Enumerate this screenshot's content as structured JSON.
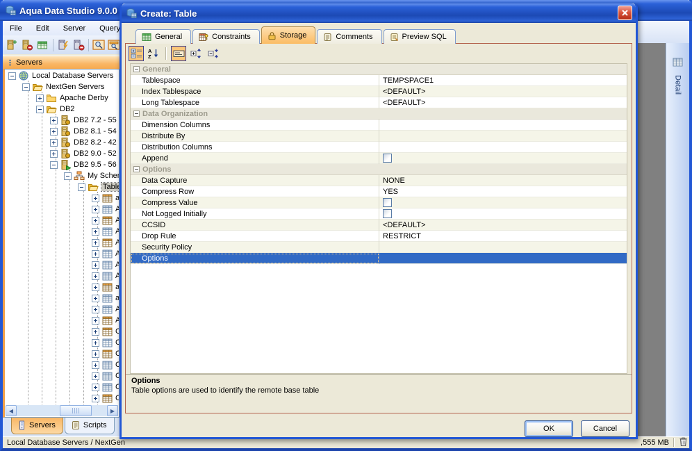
{
  "window": {
    "title": "Aqua Data Studio 9.0.0",
    "controls": [
      "minimize",
      "maximize",
      "close"
    ]
  },
  "menubar": {
    "items": [
      "File",
      "Edit",
      "Server",
      "Query"
    ]
  },
  "main_toolbar": {
    "buttons": [
      "register-server",
      "remove-server",
      "new-table",
      "connect-server",
      "disconnect-server",
      "query-analyzer",
      "query-window"
    ]
  },
  "sidebar": {
    "header": "Servers",
    "tree": [
      {
        "label": "Local Database Servers",
        "depth": 0,
        "icon": "globe",
        "toggle": "minus"
      },
      {
        "label": "NextGen Servers",
        "depth": 1,
        "icon": "folder-open",
        "toggle": "minus"
      },
      {
        "label": "Apache Derby",
        "depth": 2,
        "icon": "folder",
        "toggle": "plus"
      },
      {
        "label": "DB2",
        "depth": 2,
        "icon": "folder-open",
        "toggle": "minus"
      },
      {
        "label": "DB2 7.2 - 55",
        "depth": 3,
        "icon": "server",
        "toggle": "plus"
      },
      {
        "label": "DB2 8.1 - 54",
        "depth": 3,
        "icon": "server",
        "toggle": "plus"
      },
      {
        "label": "DB2 8.2 - 42",
        "depth": 3,
        "icon": "server",
        "toggle": "plus"
      },
      {
        "label": "DB2 9.0 - 52",
        "depth": 3,
        "icon": "server",
        "toggle": "plus"
      },
      {
        "label": "DB2 9.5 - 56",
        "depth": 3,
        "icon": "server-connected",
        "toggle": "minus"
      },
      {
        "label": "My Schem",
        "depth": 4,
        "icon": "schema",
        "toggle": "minus"
      },
      {
        "label": "Table",
        "depth": 5,
        "icon": "folder-open",
        "toggle": "minus",
        "selected": true
      },
      {
        "label": "a",
        "depth": 6,
        "icon": "table-orange",
        "toggle": "plus"
      },
      {
        "label": "A",
        "depth": 6,
        "icon": "table",
        "toggle": "plus"
      },
      {
        "label": "A",
        "depth": 6,
        "icon": "table-orange",
        "toggle": "plus"
      },
      {
        "label": "A",
        "depth": 6,
        "icon": "table",
        "toggle": "plus"
      },
      {
        "label": "A",
        "depth": 6,
        "icon": "table-orange",
        "toggle": "plus"
      },
      {
        "label": "A",
        "depth": 6,
        "icon": "table",
        "toggle": "plus"
      },
      {
        "label": "A",
        "depth": 6,
        "icon": "table",
        "toggle": "plus"
      },
      {
        "label": "A",
        "depth": 6,
        "icon": "table",
        "toggle": "plus"
      },
      {
        "label": "a",
        "depth": 6,
        "icon": "table-orange",
        "toggle": "plus"
      },
      {
        "label": "a",
        "depth": 6,
        "icon": "table",
        "toggle": "plus"
      },
      {
        "label": "A",
        "depth": 6,
        "icon": "table",
        "toggle": "plus"
      },
      {
        "label": "A",
        "depth": 6,
        "icon": "table-orange",
        "toggle": "plus"
      },
      {
        "label": "C",
        "depth": 6,
        "icon": "table-orange",
        "toggle": "plus"
      },
      {
        "label": "C",
        "depth": 6,
        "icon": "table",
        "toggle": "plus"
      },
      {
        "label": "C",
        "depth": 6,
        "icon": "table-orange",
        "toggle": "plus"
      },
      {
        "label": "C",
        "depth": 6,
        "icon": "table",
        "toggle": "plus"
      },
      {
        "label": "C",
        "depth": 6,
        "icon": "table",
        "toggle": "plus"
      },
      {
        "label": "C",
        "depth": 6,
        "icon": "table",
        "toggle": "plus"
      },
      {
        "label": "C",
        "depth": 6,
        "icon": "table-orange",
        "toggle": "plus"
      }
    ],
    "tabs": [
      {
        "label": "Servers",
        "icon": "computer",
        "active": true
      },
      {
        "label": "Scripts",
        "icon": "script",
        "active": false
      }
    ]
  },
  "statusbar": {
    "left": "Local Database Servers / NextGen",
    "memory": ",555 MB"
  },
  "detail_panel": {
    "label": "Detail"
  },
  "dialog": {
    "title": "Create: Table",
    "tabs": [
      {
        "label": "General",
        "icon": "general",
        "active": false
      },
      {
        "label": "Constraints",
        "icon": "constraints",
        "active": false
      },
      {
        "label": "Storage",
        "icon": "storage",
        "active": true
      },
      {
        "label": "Comments",
        "icon": "comments",
        "active": false
      },
      {
        "label": "Preview SQL",
        "icon": "preview-sql",
        "active": false
      }
    ],
    "toolbar": [
      {
        "icon": "categorized",
        "pressed": true
      },
      {
        "icon": "sort-az",
        "pressed": false
      },
      {
        "icon": "separator"
      },
      {
        "icon": "description",
        "pressed": true
      },
      {
        "icon": "expand-all",
        "pressed": false
      },
      {
        "icon": "collapse-all",
        "pressed": false
      }
    ],
    "grid": {
      "rows": [
        {
          "type": "category",
          "label": "General"
        },
        {
          "type": "property",
          "name": "Tablespace",
          "kind": "text",
          "value": "TEMPSPACE1"
        },
        {
          "type": "property",
          "name": "Index Tablespace",
          "kind": "text",
          "value": "<DEFAULT>"
        },
        {
          "type": "property",
          "name": "Long Tablespace",
          "kind": "text",
          "value": "<DEFAULT>"
        },
        {
          "type": "category",
          "label": "Data Organization"
        },
        {
          "type": "property",
          "name": "Dimension Columns",
          "kind": "text",
          "value": ""
        },
        {
          "type": "property",
          "name": "Distribute By",
          "kind": "text",
          "value": ""
        },
        {
          "type": "property",
          "name": "Distribution Columns",
          "kind": "text",
          "value": ""
        },
        {
          "type": "property",
          "name": "Append",
          "kind": "checkbox",
          "checked": false
        },
        {
          "type": "category",
          "label": "Options"
        },
        {
          "type": "property",
          "name": "Data Capture",
          "kind": "text",
          "value": "NONE"
        },
        {
          "type": "property",
          "name": "Compress Row",
          "kind": "text",
          "value": "YES"
        },
        {
          "type": "property",
          "name": "Compress Value",
          "kind": "checkbox",
          "checked": false
        },
        {
          "type": "property",
          "name": "Not Logged Initially",
          "kind": "checkbox",
          "checked": false
        },
        {
          "type": "property",
          "name": "CCSID",
          "kind": "text",
          "value": "<DEFAULT>"
        },
        {
          "type": "property",
          "name": "Drop Rule",
          "kind": "text",
          "value": "RESTRICT"
        },
        {
          "type": "property",
          "name": "Security Policy",
          "kind": "text",
          "value": ""
        },
        {
          "type": "property",
          "name": "Options",
          "kind": "text",
          "value": "",
          "selected": true
        }
      ]
    },
    "description": {
      "title": "Options",
      "text": "Table options are used to identify the remote base table"
    },
    "buttons": {
      "ok": "OK",
      "cancel": "Cancel"
    }
  },
  "colors": {
    "titlebar_blue": "#2b61d8",
    "selection_blue": "#316ac5",
    "active_tab_orange": "#fbbc64",
    "panel_border_maroon": "#b4634d",
    "dialog_beige": "#ece9d8"
  }
}
